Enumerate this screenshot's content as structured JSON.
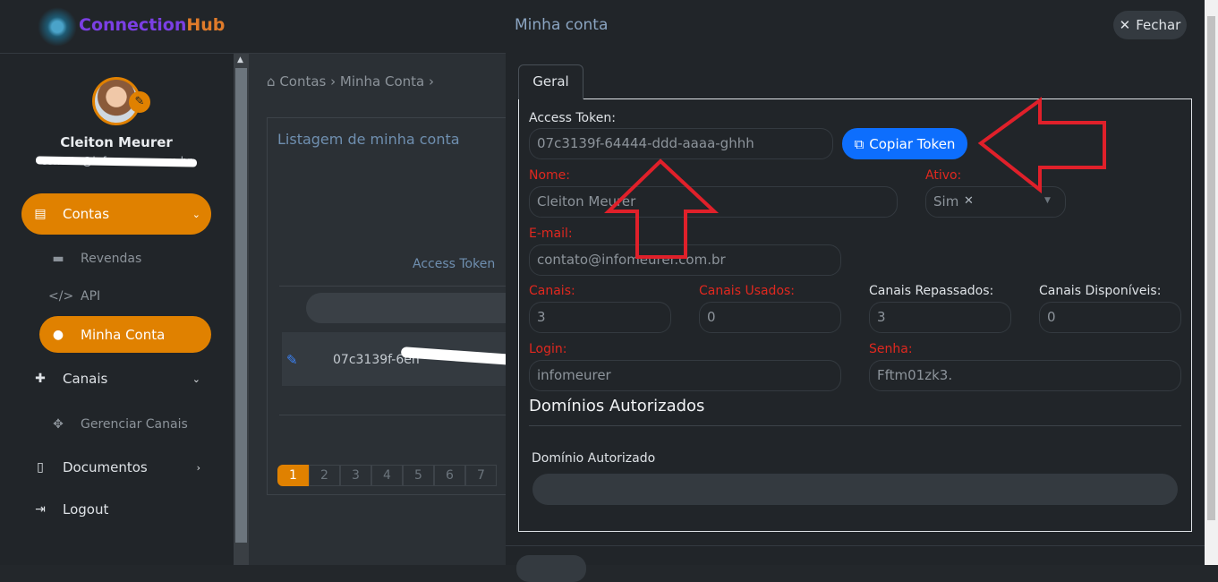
{
  "brand": {
    "name_part1": "Connection",
    "name_part2": "Hub"
  },
  "user": {
    "name": "Cleiton Meurer",
    "email": "contato@infomeurer.com.br"
  },
  "sidebar": {
    "items": [
      {
        "label": "Contas",
        "icon": "address-book-icon"
      },
      {
        "label": "Revendas",
        "icon": "id-card-icon"
      },
      {
        "label": "API",
        "icon": "code-icon"
      },
      {
        "label": "Minha Conta",
        "icon": "user-icon"
      },
      {
        "label": "Canais",
        "icon": "puzzle-icon"
      },
      {
        "label": "Gerenciar Canais",
        "icon": "move-icon"
      },
      {
        "label": "Documentos",
        "icon": "file-icon"
      },
      {
        "label": "Logout",
        "icon": "sign-out-icon"
      }
    ]
  },
  "background": {
    "breadcrumb": [
      "Contas",
      "Minha Conta"
    ],
    "card_title": "Listagem de minha conta",
    "column_access_token": "Access Token",
    "row_token": "07c3139f-6eh",
    "pages": [
      "1",
      "2",
      "3",
      "4",
      "5",
      "6",
      "7"
    ]
  },
  "modal": {
    "title": "Minha conta",
    "close_label": "Fechar",
    "tab_label": "Geral",
    "access_token_label": "Access Token:",
    "access_token_value": "07c3139f-64444-ddd-aaaa-ghhh",
    "copy_token_label": "Copiar Token",
    "nome_label": "Nome:",
    "nome_value": "Cleiton Meurer",
    "ativo_label": "Ativo:",
    "ativo_value": "Sim",
    "email_label": "E-mail:",
    "email_value": "contato@infomeurer.com.br",
    "canais_label": "Canais:",
    "canais_value": "3",
    "canais_usados_label": "Canais Usados:",
    "canais_usados_value": "0",
    "canais_repassados_label": "Canais Repassados:",
    "canais_repassados_value": "3",
    "canais_disponiveis_label": "Canais Disponíveis:",
    "canais_disponiveis_value": "0",
    "login_label": "Login:",
    "login_value": "infomeurer",
    "senha_label": "Senha:",
    "senha_value": "Fftm01zk3.",
    "dominios_title": "Domínios Autorizados",
    "dominio_label": "Domínio Autorizado"
  },
  "colors": {
    "accent": "#e08100",
    "primary": "#0d6efd",
    "required": "#e0281f"
  }
}
